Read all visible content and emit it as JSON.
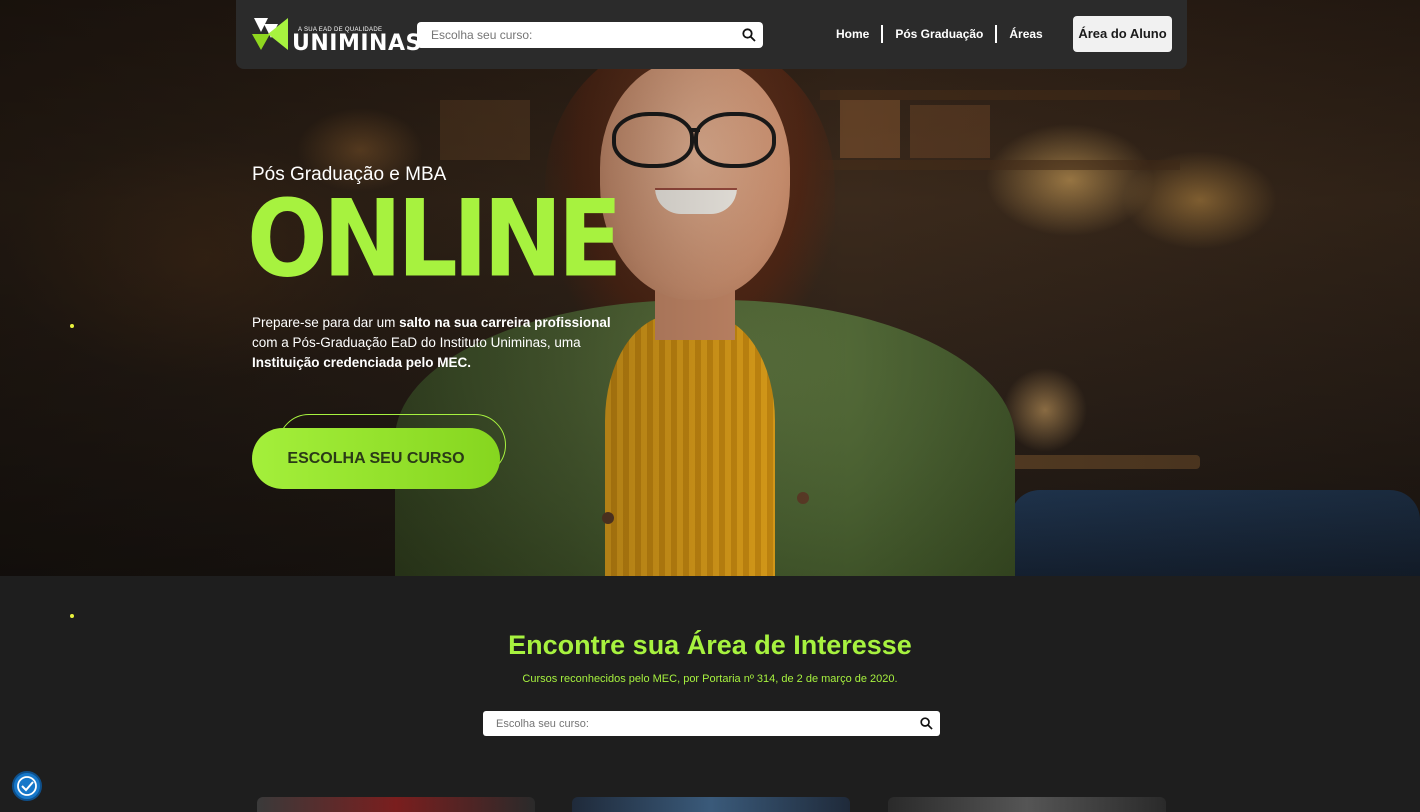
{
  "nav": {
    "logo_tagline": "A SUA EAD DE QUALIDADE",
    "logo_word": "UNIMINAS",
    "search_placeholder": "Escolha seu curso:",
    "links": [
      {
        "label": "Home"
      },
      {
        "label": "Pós Graduação"
      },
      {
        "label": "Áreas"
      }
    ],
    "student_button": "Área do Aluno"
  },
  "hero": {
    "subtitle": "Pós Graduação e MBA",
    "headline": "ONLINE",
    "desc_1": "Prepare-se para dar um ",
    "desc_bold_1": "salto na sua carreira profissional",
    "desc_2": " com a Pós-Graduação EaD do Instituto Uniminas, uma ",
    "desc_bold_2": "Instituição credenciada pelo MEC.",
    "cta": "ESCOLHA SEU CURSO"
  },
  "section": {
    "title": "Encontre sua Área de Interesse",
    "subtitle": "Cursos reconhecidos pelo MEC, por Portaria nº 314, de 2 de março de 2020.",
    "search_placeholder": "Escolha seu curso:"
  },
  "colors": {
    "accent": "#a7f23f",
    "nav_bg": "#2b2b2b",
    "page_bg": "#1e1e1e"
  },
  "icons": [
    "search-icon",
    "accessibility-icon",
    "logo-mark-icon"
  ]
}
